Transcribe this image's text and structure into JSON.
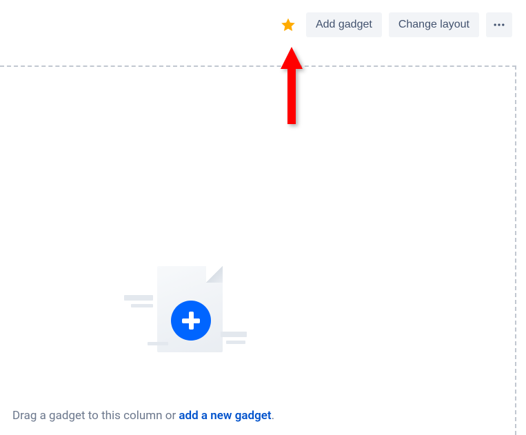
{
  "toolbar": {
    "star_icon": "star-icon",
    "add_gadget_label": "Add gadget",
    "change_layout_label": "Change layout",
    "more_icon": "more-horizontal-icon"
  },
  "empty_state": {
    "prefix_text": "Drag a gadget to this column or ",
    "link_text": "add a new gadget",
    "suffix_text": "."
  },
  "colors": {
    "button_bg": "#f2f4f7",
    "button_text": "#42526e",
    "star": "#ffab00",
    "link": "#0052cc",
    "accent": "#0065ff",
    "arrow": "#ff0000"
  }
}
